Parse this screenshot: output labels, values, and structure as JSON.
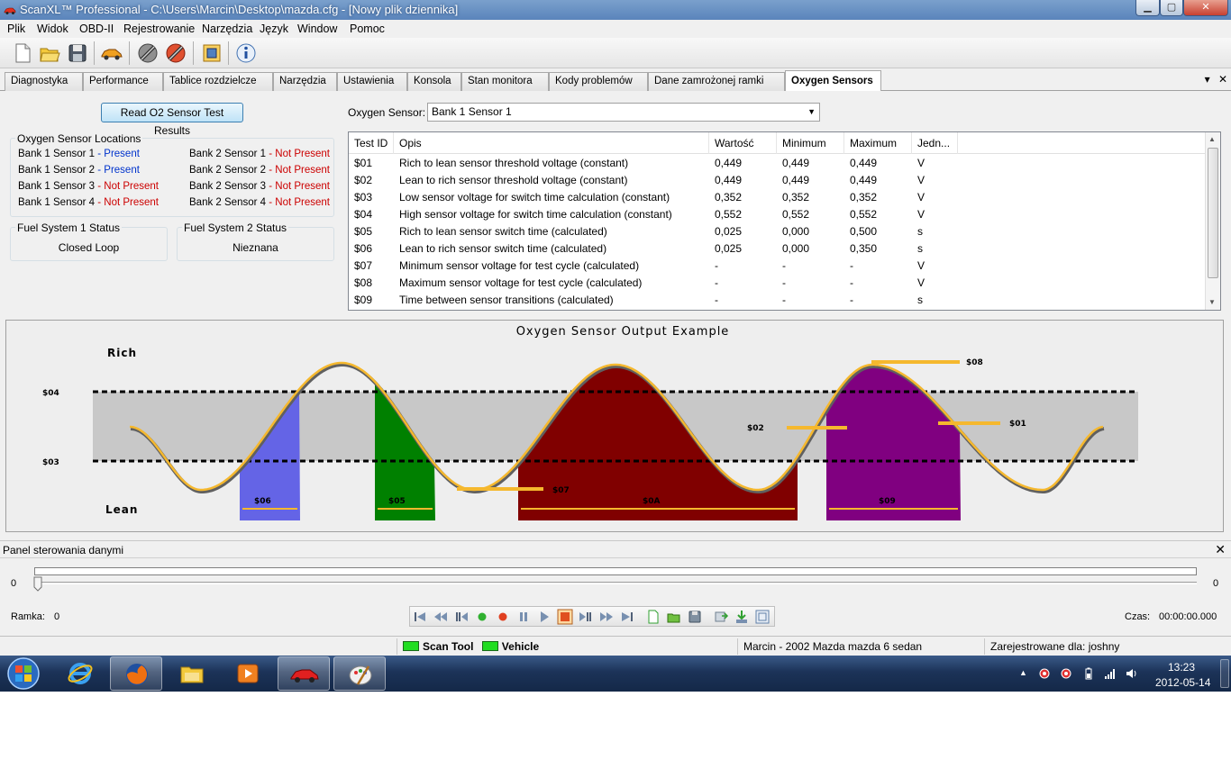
{
  "window": {
    "title": "ScanXL™ Professional - C:\\Users\\Marcin\\Desktop\\mazda.cfg - [Nowy plik dziennika]",
    "min_glyph": "▁",
    "max_glyph": "▢",
    "close_glyph": "✕"
  },
  "menu": [
    "Plik",
    "Widok",
    "OBD-II",
    "Rejestrowanie",
    "Narzędzia",
    "Język",
    "Window",
    "Pomoc"
  ],
  "toolbar_icons": [
    "new-file-icon",
    "open-folder-icon",
    "save-disk-icon",
    "car-connect-icon",
    "connect-plug-icon",
    "disconnect-plug-icon",
    "config-frame-icon",
    "info-icon"
  ],
  "tabs": [
    {
      "label": "Diagnostyka"
    },
    {
      "label": "Performance"
    },
    {
      "label": "Tablice rozdzielcze"
    },
    {
      "label": "Narzędzia"
    },
    {
      "label": "Ustawienia"
    },
    {
      "label": "Konsola"
    },
    {
      "label": "Stan monitora"
    },
    {
      "label": "Kody problemów"
    },
    {
      "label": "Dane zamrożonej ramki"
    },
    {
      "label": "Oxygen Sensors",
      "active": true
    }
  ],
  "tab_controls": {
    "menu": "▾",
    "close": "✕"
  },
  "read_button": "Read O2 Sensor Test Results",
  "locations": {
    "title": "Oxygen Sensor Locations",
    "separator": "-",
    "bank1": [
      {
        "name": "Bank 1 Sensor 1",
        "status": "Present"
      },
      {
        "name": "Bank 1 Sensor 2",
        "status": "Present"
      },
      {
        "name": "Bank 1 Sensor 3",
        "status": "Not Present"
      },
      {
        "name": "Bank 1 Sensor 4",
        "status": "Not Present"
      }
    ],
    "bank2": [
      {
        "name": "Bank 2 Sensor 1",
        "status": "Not Present"
      },
      {
        "name": "Bank 2 Sensor 2",
        "status": "Not Present"
      },
      {
        "name": "Bank 2 Sensor 3",
        "status": "Not Present"
      },
      {
        "name": "Bank 2 Sensor 4",
        "status": "Not Present"
      }
    ]
  },
  "fuel1": {
    "title": "Fuel System 1 Status",
    "value": "Closed Loop"
  },
  "fuel2": {
    "title": "Fuel System 2 Status",
    "value": "Nieznana"
  },
  "o2": {
    "label": "Oxygen Sensor:",
    "selected": "Bank 1 Sensor 1"
  },
  "table": {
    "headers": [
      "Test ID",
      "Opis",
      "Wartość",
      "Minimum",
      "Maximum",
      "Jedn..."
    ],
    "rows": [
      [
        "$01",
        "Rich to lean sensor threshold voltage (constant)",
        "0,449",
        "0,449",
        "0,449",
        "V"
      ],
      [
        "$02",
        "Lean to rich sensor threshold voltage (constant)",
        "0,449",
        "0,449",
        "0,449",
        "V"
      ],
      [
        "$03",
        "Low sensor voltage for switch time calculation (constant)",
        "0,352",
        "0,352",
        "0,352",
        "V"
      ],
      [
        "$04",
        "High sensor voltage for switch time calculation (constant)",
        "0,552",
        "0,552",
        "0,552",
        "V"
      ],
      [
        "$05",
        "Rich to lean sensor switch time (calculated)",
        "0,025",
        "0,000",
        "0,500",
        "s"
      ],
      [
        "$06",
        "Lean to rich sensor switch time (calculated)",
        "0,025",
        "0,000",
        "0,350",
        "s"
      ],
      [
        "$07",
        "Minimum sensor voltage for test cycle (calculated)",
        "-",
        "-",
        "-",
        "V"
      ],
      [
        "$08",
        "Maximum sensor voltage for test cycle (calculated)",
        "-",
        "-",
        "-",
        "V"
      ],
      [
        "$09",
        "Time between sensor transitions (calculated)",
        "-",
        "-",
        "-",
        "s"
      ]
    ]
  },
  "diagram": {
    "title": "Oxygen Sensor Output Example",
    "rich": "Rich",
    "lean": "Lean",
    "labels": {
      "s01": "$01",
      "s02": "$02",
      "s03": "$03",
      "s04": "$04",
      "s05": "$05",
      "s06": "$06",
      "s07": "$07",
      "s08": "$08",
      "s09": "$09",
      "s0a": "$0A"
    },
    "colors": {
      "band": "#c8c8c8",
      "wave": "#f5b82e",
      "s06": "#6464e6",
      "s05": "#008000",
      "s0a": "#800000",
      "s09": "#800080",
      "marker": "#f5b82e"
    }
  },
  "control": {
    "title": "Panel sterowania danymi",
    "close": "✕",
    "slider_min": "0",
    "slider_max": "0",
    "frame_label": "Ramka:",
    "frame_value": "0",
    "time_label": "Czas:",
    "time_value": "00:00:00.000"
  },
  "status": {
    "scan_tool": "Scan Tool",
    "vehicle": "Vehicle",
    "user_vehicle": "Marcin - 2002 Mazda mazda 6 sedan",
    "registered": "Zarejestrowane dla: joshny"
  },
  "taskbar": {
    "apps": [
      "start-orb-icon",
      "internet-explorer-icon",
      "firefox-icon",
      "explorer-folder-icon",
      "media-player-icon",
      "scanxl-car-icon",
      "paint-icon"
    ],
    "time": "13:23",
    "date": "2012-05-14",
    "tray_arrow": "▲"
  }
}
